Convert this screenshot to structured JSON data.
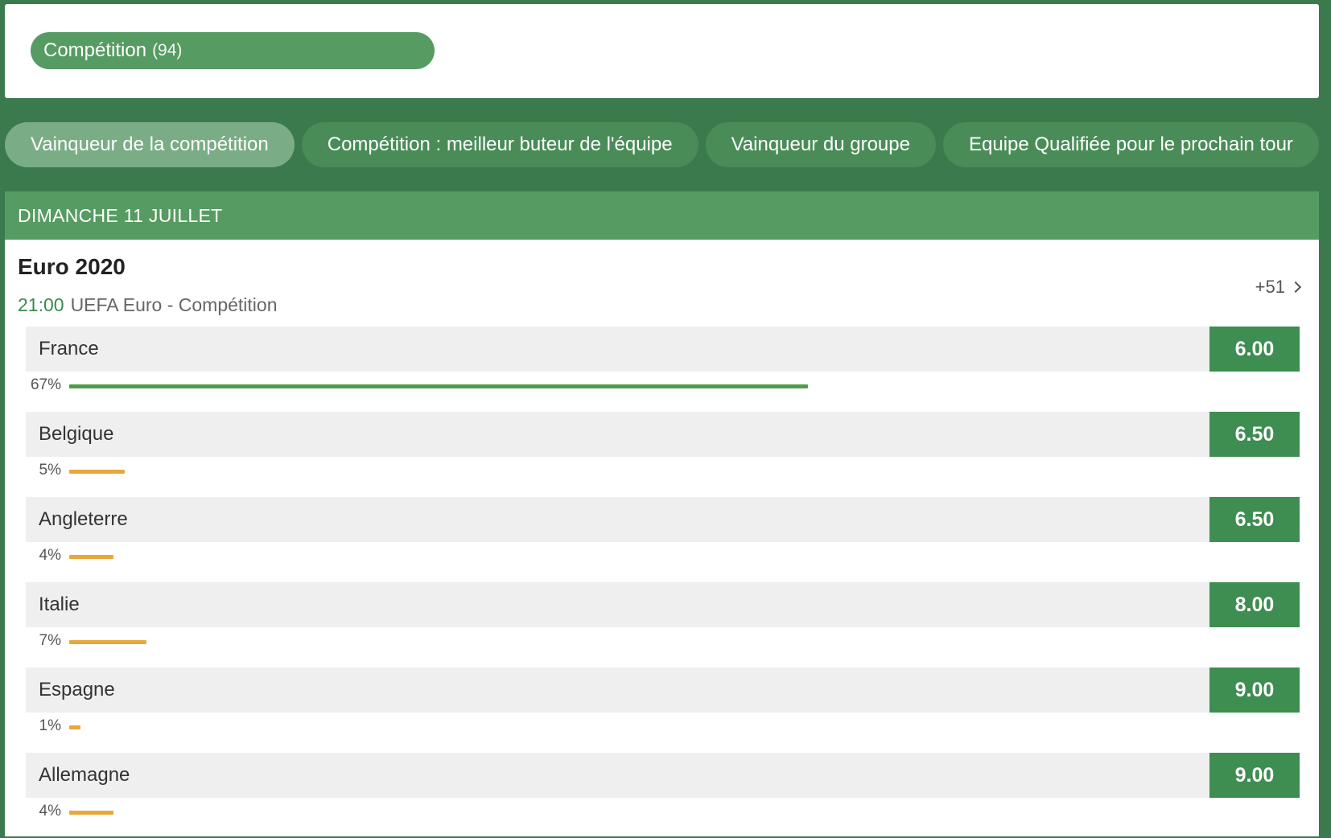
{
  "competition_filter": {
    "label": "Compétition",
    "count": "(94)"
  },
  "tabs": [
    {
      "label": "Vainqueur de la compétition",
      "active": true
    },
    {
      "label": "Compétition : meilleur buteur de l'équipe",
      "active": false
    },
    {
      "label": "Vainqueur du groupe",
      "active": false
    },
    {
      "label": "Equipe Qualifiée pour le prochain tour",
      "active": false
    }
  ],
  "date_header": "DIMANCHE 11 JUILLET",
  "event": {
    "title": "Euro 2020",
    "time": "21:00",
    "subtitle": "UEFA Euro - Compétition",
    "more_markets": "+51"
  },
  "outcomes": [
    {
      "team": "France",
      "odd": "6.00",
      "percent_label": "67%",
      "percent": 67,
      "bar_color": "green"
    },
    {
      "team": "Belgique",
      "odd": "6.50",
      "percent_label": "5%",
      "percent": 5,
      "bar_color": "orange"
    },
    {
      "team": "Angleterre",
      "odd": "6.50",
      "percent_label": "4%",
      "percent": 4,
      "bar_color": "orange"
    },
    {
      "team": "Italie",
      "odd": "8.00",
      "percent_label": "7%",
      "percent": 7,
      "bar_color": "orange"
    },
    {
      "team": "Espagne",
      "odd": "9.00",
      "percent_label": "1%",
      "percent": 1,
      "bar_color": "orange"
    },
    {
      "team": "Allemagne",
      "odd": "9.00",
      "percent_label": "4%",
      "percent": 4,
      "bar_color": "orange"
    }
  ],
  "colors": {
    "page_background": "#3b7a4d",
    "brand_green": "#559b62",
    "odd_green": "#3e8d51",
    "bar_green": "#4f9c4a",
    "bar_orange": "#e9a63b"
  }
}
